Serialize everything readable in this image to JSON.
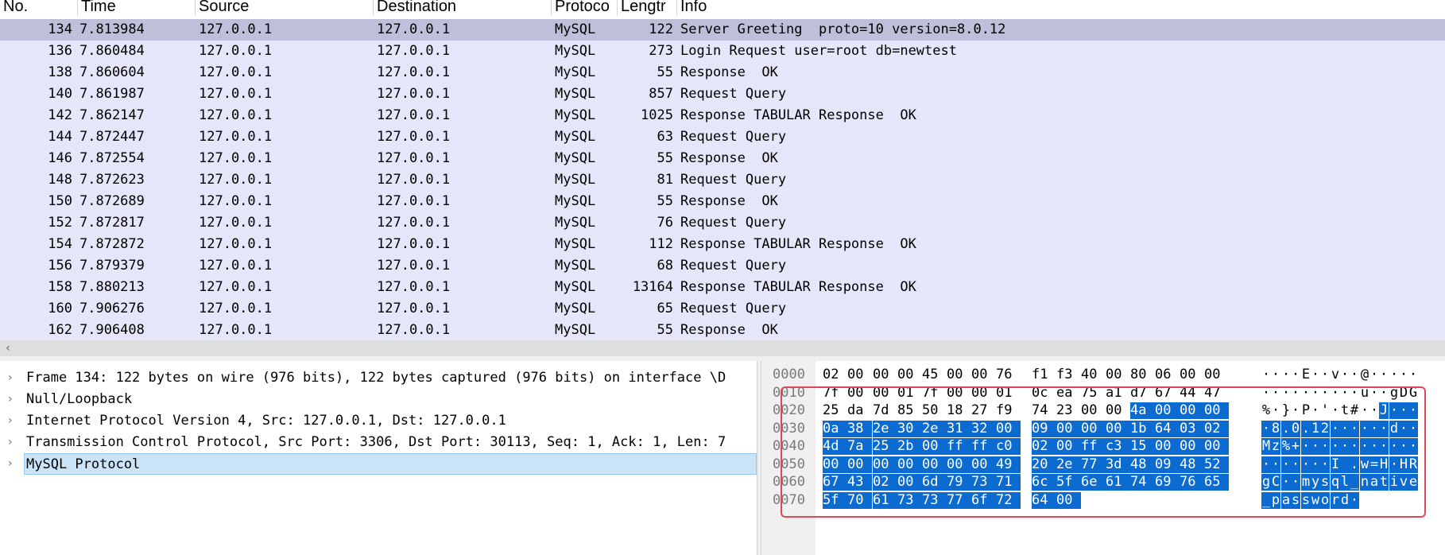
{
  "packet_list": {
    "columns": [
      "No.",
      "Time",
      "Source",
      "Destination",
      "Protoco",
      "Lengtr",
      "Info"
    ],
    "rows": [
      {
        "no": "134",
        "time": "7.813984",
        "src": "127.0.0.1",
        "dst": "127.0.0.1",
        "proto": "MySQL",
        "len": "122",
        "info": "Server Greeting  proto=10 version=8.0.12"
      },
      {
        "no": "136",
        "time": "7.860484",
        "src": "127.0.0.1",
        "dst": "127.0.0.1",
        "proto": "MySQL",
        "len": "273",
        "info": "Login Request user=root db=newtest"
      },
      {
        "no": "138",
        "time": "7.860604",
        "src": "127.0.0.1",
        "dst": "127.0.0.1",
        "proto": "MySQL",
        "len": "55",
        "info": "Response  OK"
      },
      {
        "no": "140",
        "time": "7.861987",
        "src": "127.0.0.1",
        "dst": "127.0.0.1",
        "proto": "MySQL",
        "len": "857",
        "info": "Request Query"
      },
      {
        "no": "142",
        "time": "7.862147",
        "src": "127.0.0.1",
        "dst": "127.0.0.1",
        "proto": "MySQL",
        "len": "1025",
        "info": "Response TABULAR Response  OK"
      },
      {
        "no": "144",
        "time": "7.872447",
        "src": "127.0.0.1",
        "dst": "127.0.0.1",
        "proto": "MySQL",
        "len": "63",
        "info": "Request Query"
      },
      {
        "no": "146",
        "time": "7.872554",
        "src": "127.0.0.1",
        "dst": "127.0.0.1",
        "proto": "MySQL",
        "len": "55",
        "info": "Response  OK"
      },
      {
        "no": "148",
        "time": "7.872623",
        "src": "127.0.0.1",
        "dst": "127.0.0.1",
        "proto": "MySQL",
        "len": "81",
        "info": "Request Query"
      },
      {
        "no": "150",
        "time": "7.872689",
        "src": "127.0.0.1",
        "dst": "127.0.0.1",
        "proto": "MySQL",
        "len": "55",
        "info": "Response  OK"
      },
      {
        "no": "152",
        "time": "7.872817",
        "src": "127.0.0.1",
        "dst": "127.0.0.1",
        "proto": "MySQL",
        "len": "76",
        "info": "Request Query"
      },
      {
        "no": "154",
        "time": "7.872872",
        "src": "127.0.0.1",
        "dst": "127.0.0.1",
        "proto": "MySQL",
        "len": "112",
        "info": "Response TABULAR Response  OK"
      },
      {
        "no": "156",
        "time": "7.879379",
        "src": "127.0.0.1",
        "dst": "127.0.0.1",
        "proto": "MySQL",
        "len": "68",
        "info": "Request Query"
      },
      {
        "no": "158",
        "time": "7.880213",
        "src": "127.0.0.1",
        "dst": "127.0.0.1",
        "proto": "MySQL",
        "len": "13164",
        "info": "Response TABULAR Response  OK"
      },
      {
        "no": "160",
        "time": "7.906276",
        "src": "127.0.0.1",
        "dst": "127.0.0.1",
        "proto": "MySQL",
        "len": "65",
        "info": "Request Query"
      },
      {
        "no": "162",
        "time": "7.906408",
        "src": "127.0.0.1",
        "dst": "127.0.0.1",
        "proto": "MySQL",
        "len": "55",
        "info": "Response  OK"
      }
    ],
    "selected_no": "134"
  },
  "detail_tree": [
    {
      "text": "Frame 134: 122 bytes on wire (976 bits), 122 bytes captured (976 bits) on interface \\D",
      "selected": false
    },
    {
      "text": "Null/Loopback",
      "selected": false
    },
    {
      "text": "Internet Protocol Version 4, Src: 127.0.0.1, Dst: 127.0.0.1",
      "selected": false
    },
    {
      "text": "Transmission Control Protocol, Src Port: 3306, Dst Port: 30113, Seq: 1, Ack: 1, Len: 7",
      "selected": false
    },
    {
      "text": "MySQL Protocol",
      "selected": true
    }
  ],
  "hex_dump": {
    "rows": [
      {
        "offset": "0000",
        "bytes": [
          "02",
          "00",
          "00",
          "00",
          "45",
          "00",
          "00",
          "76",
          "f1",
          "f3",
          "40",
          "00",
          "80",
          "06",
          "00",
          "00"
        ],
        "ascii": [
          "·",
          "·",
          "·",
          "·",
          "E",
          "·",
          "·",
          "v",
          "·",
          "·",
          "@",
          "·",
          "·",
          "·",
          "·",
          "·"
        ]
      },
      {
        "offset": "0010",
        "bytes": [
          "7f",
          "00",
          "00",
          "01",
          "7f",
          "00",
          "00",
          "01",
          "0c",
          "ea",
          "75",
          "a1",
          "d7",
          "67",
          "44",
          "47"
        ],
        "ascii": [
          "·",
          "·",
          "·",
          "·",
          "·",
          "·",
          "·",
          "·",
          "·",
          "·",
          "u",
          "·",
          "·",
          "g",
          "D",
          "G"
        ]
      },
      {
        "offset": "0020",
        "bytes": [
          "25",
          "da",
          "7d",
          "85",
          "50",
          "18",
          "27",
          "f9",
          "74",
          "23",
          "00",
          "00",
          "4a",
          "00",
          "00",
          "00"
        ],
        "ascii": [
          "%",
          "·",
          "}",
          "·",
          "P",
          "·",
          "'",
          "·",
          "t",
          "#",
          "·",
          "·",
          "J",
          "·",
          "·",
          "·"
        ]
      },
      {
        "offset": "0030",
        "bytes": [
          "0a",
          "38",
          "2e",
          "30",
          "2e",
          "31",
          "32",
          "00",
          "09",
          "00",
          "00",
          "00",
          "1b",
          "64",
          "03",
          "02"
        ],
        "ascii": [
          "·",
          "8",
          ".",
          "0",
          ".",
          "1",
          "2",
          "·",
          "·",
          "·",
          "·",
          "·",
          "·",
          "d",
          "·",
          "·"
        ]
      },
      {
        "offset": "0040",
        "bytes": [
          "4d",
          "7a",
          "25",
          "2b",
          "00",
          "ff",
          "ff",
          "c0",
          "02",
          "00",
          "ff",
          "c3",
          "15",
          "00",
          "00",
          "00"
        ],
        "ascii": [
          "M",
          "z",
          "%",
          "+",
          "·",
          "·",
          "·",
          "·",
          "·",
          "·",
          "·",
          "·",
          "·",
          "·",
          "·",
          "·"
        ]
      },
      {
        "offset": "0050",
        "bytes": [
          "00",
          "00",
          "00",
          "00",
          "00",
          "00",
          "00",
          "49",
          "20",
          "2e",
          "77",
          "3d",
          "48",
          "09",
          "48",
          "52"
        ],
        "ascii": [
          "·",
          "·",
          "·",
          "·",
          "·",
          "·",
          "·",
          "I",
          " ",
          ".",
          "w",
          "=",
          "H",
          "·",
          "H",
          "R"
        ]
      },
      {
        "offset": "0060",
        "bytes": [
          "67",
          "43",
          "02",
          "00",
          "6d",
          "79",
          "73",
          "71",
          "6c",
          "5f",
          "6e",
          "61",
          "74",
          "69",
          "76",
          "65"
        ],
        "ascii": [
          "g",
          "C",
          "·",
          "·",
          "m",
          "y",
          "s",
          "q",
          "l",
          "_",
          "n",
          "a",
          "t",
          "i",
          "v",
          "e"
        ]
      },
      {
        "offset": "0070",
        "bytes": [
          "5f",
          "70",
          "61",
          "73",
          "73",
          "77",
          "6f",
          "72",
          "64",
          "00"
        ],
        "ascii": [
          "_",
          "p",
          "a",
          "s",
          "s",
          "w",
          "o",
          "r",
          "d",
          "·"
        ]
      }
    ],
    "highlight_start_row": 2,
    "highlight_start_col": 12
  },
  "colors": {
    "row_bg": "#e6e6fa",
    "row_selected_bg": "#c0bfda",
    "hex_highlight": "#0b6bd1",
    "annotation_box": "#e0485a"
  }
}
